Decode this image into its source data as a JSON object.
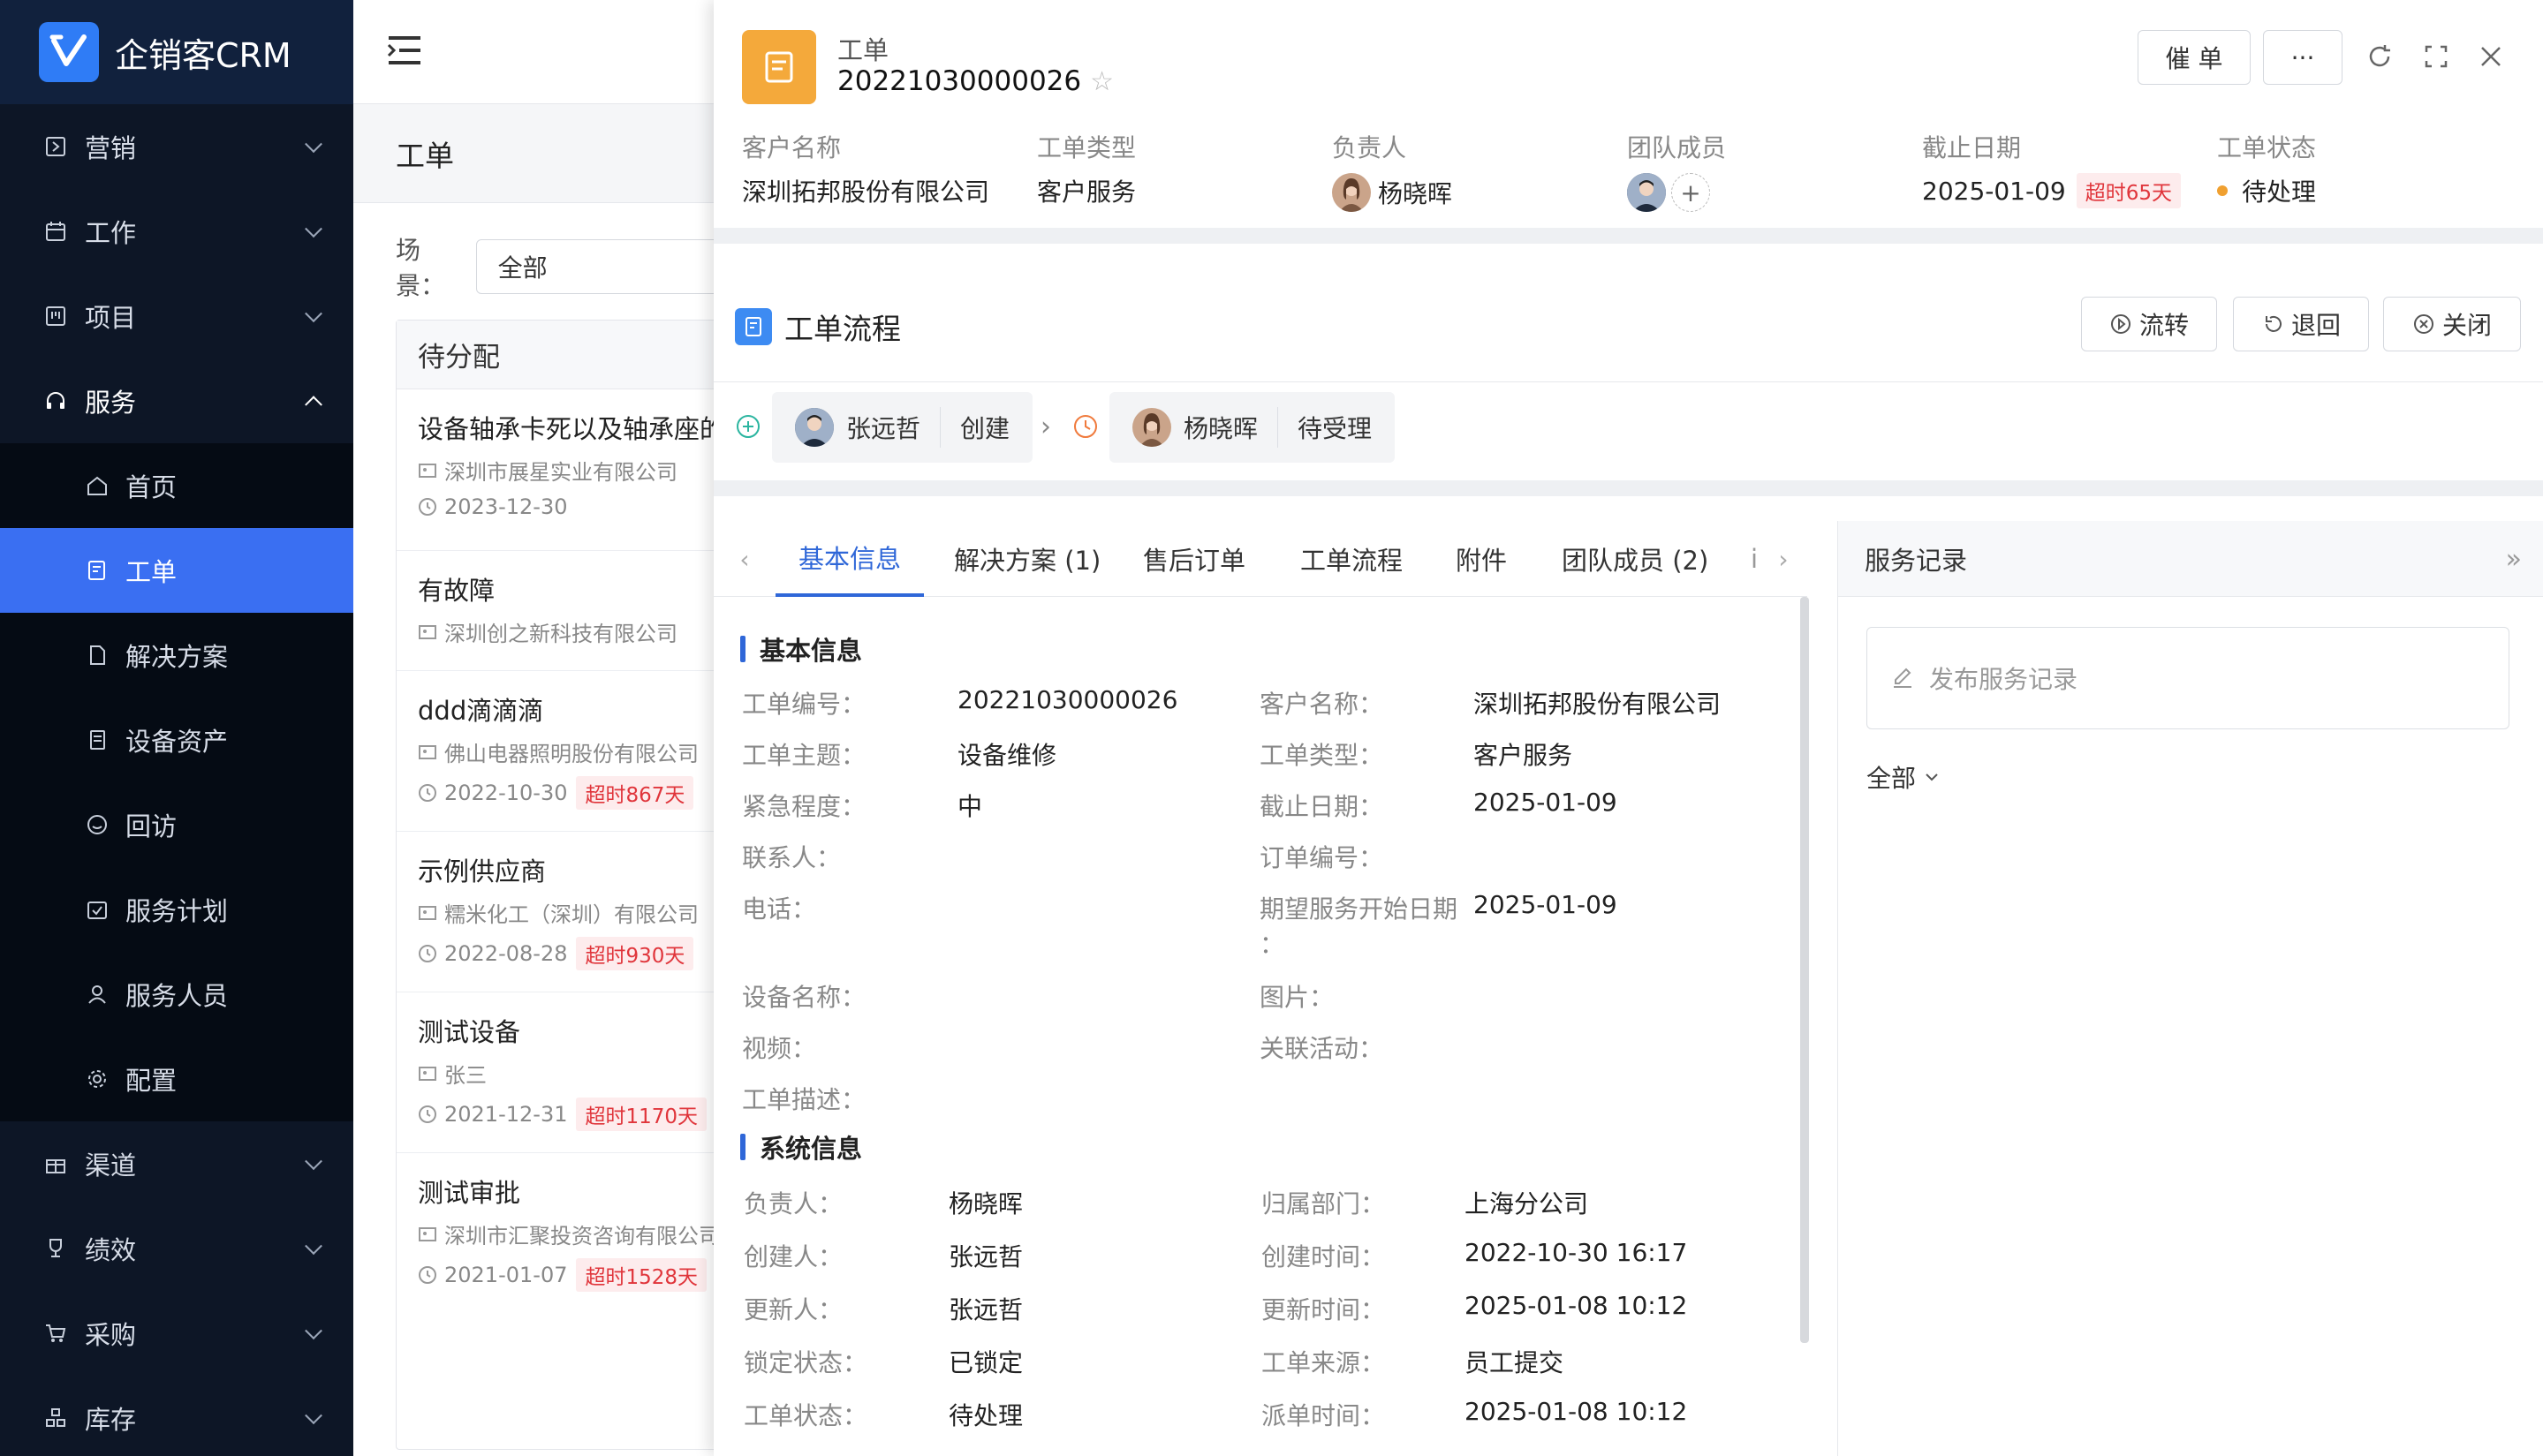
{
  "app": {
    "name": "企销客CRM"
  },
  "sidebar": {
    "top_items": [
      {
        "label": "营销",
        "icon": "marketing-icon"
      },
      {
        "label": "工作",
        "icon": "calendar-icon"
      },
      {
        "label": "项目",
        "icon": "project-icon"
      },
      {
        "label": "服务",
        "icon": "headset-icon"
      }
    ],
    "service_sub": [
      {
        "label": "首页",
        "icon": "home-icon"
      },
      {
        "label": "工单",
        "icon": "ticket-icon"
      },
      {
        "label": "解决方案",
        "icon": "document-icon"
      },
      {
        "label": "设备资产",
        "icon": "asset-icon"
      },
      {
        "label": "回访",
        "icon": "smile-icon"
      },
      {
        "label": "服务计划",
        "icon": "plan-icon"
      },
      {
        "label": "服务人员",
        "icon": "person-icon"
      },
      {
        "label": "配置",
        "icon": "gear-icon"
      }
    ],
    "bottom_items": [
      {
        "label": "渠道",
        "icon": "gift-icon"
      },
      {
        "label": "绩效",
        "icon": "trophy-icon"
      },
      {
        "label": "采购",
        "icon": "cart-icon"
      },
      {
        "label": "库存",
        "icon": "stock-icon"
      }
    ]
  },
  "list": {
    "page_title": "工单",
    "scene_label": "场景：",
    "scene_value": "全部",
    "column_title": "待分配",
    "cards": [
      {
        "title": "设备轴承卡死以及轴承座的",
        "company": "深圳市展星实业有限公司",
        "date": "2023-12-30",
        "overdue": ""
      },
      {
        "title": "有故障",
        "company": "深圳创之新科技有限公司",
        "date": "",
        "overdue": ""
      },
      {
        "title": "ddd滴滴滴",
        "company": "佛山电器照明股份有限公司",
        "date": "2022-10-30",
        "overdue": "超时867天"
      },
      {
        "title": "示例供应商",
        "company": "糯米化工（深圳）有限公司",
        "date": "2022-08-28",
        "overdue": "超时930天"
      },
      {
        "title": "测试设备",
        "company": "张三",
        "date": "2021-12-31",
        "overdue": "超时1170天"
      },
      {
        "title": "测试审批",
        "company": "深圳市汇聚投资咨询有限公司",
        "date": "2021-01-07",
        "overdue": "超时1528天"
      }
    ]
  },
  "drawer": {
    "kind": "工单",
    "number": "20221030000026",
    "buttons": {
      "urge": "催 单",
      "more": "···"
    },
    "meta": {
      "customer_label": "客户名称",
      "customer": "深圳拓邦股份有限公司",
      "type_label": "工单类型",
      "type": "客户服务",
      "owner_label": "负责人",
      "owner": "杨晓晖",
      "team_label": "团队成员",
      "due_label": "截止日期",
      "due": "2025-01-09",
      "due_overdue": "超时65天",
      "status_label": "工单状态",
      "status": "待处理"
    },
    "flow": {
      "title": "工单流程",
      "actions": {
        "transfer": "流转",
        "return": "退回",
        "close": "关闭"
      },
      "steps": [
        {
          "person": "张远哲",
          "action": "创建"
        },
        {
          "person": "杨晓晖",
          "action": "待受理"
        }
      ]
    },
    "tabs": [
      "基本信息",
      "解决方案 (1)",
      "售后订单",
      "工单流程",
      "附件",
      "团队成员 (2)",
      "i"
    ],
    "basic": {
      "section1": "基本信息",
      "fields_left": [
        {
          "k": "工单编号：",
          "v": "20221030000026"
        },
        {
          "k": "工单主题：",
          "v": "设备维修"
        },
        {
          "k": "紧急程度：",
          "v": "中"
        },
        {
          "k": "联系人：",
          "v": ""
        },
        {
          "k": "电话：",
          "v": ""
        },
        {
          "k": "设备名称：",
          "v": ""
        },
        {
          "k": "视频：",
          "v": ""
        },
        {
          "k": "工单描述：",
          "v": ""
        }
      ],
      "fields_right": [
        {
          "k": "客户名称：",
          "v": "深圳拓邦股份有限公司"
        },
        {
          "k": "工单类型：",
          "v": "客户服务"
        },
        {
          "k": "截止日期：",
          "v": "2025-01-09"
        },
        {
          "k": "订单编号：",
          "v": ""
        },
        {
          "k": "期望服务开始日期",
          "k2": "：",
          "v": "2025-01-09"
        },
        {
          "k": "图片：",
          "v": ""
        },
        {
          "k": "关联活动：",
          "v": ""
        }
      ],
      "section2": "系统信息",
      "sys_left": [
        {
          "k": "负责人：",
          "v": "杨晓晖"
        },
        {
          "k": "创建人：",
          "v": "张远哲"
        },
        {
          "k": "更新人：",
          "v": "张远哲"
        },
        {
          "k": "锁定状态：",
          "v": "已锁定"
        },
        {
          "k": "工单状态：",
          "v": "待处理"
        }
      ],
      "sys_right": [
        {
          "k": "归属部门：",
          "v": "上海分公司"
        },
        {
          "k": "创建时间：",
          "v": "2022-10-30 16:17"
        },
        {
          "k": "更新时间：",
          "v": "2025-01-08 10:12"
        },
        {
          "k": "工单来源：",
          "v": "员工提交"
        },
        {
          "k": "派单时间：",
          "v": "2025-01-08 10:12"
        }
      ]
    },
    "service_record": {
      "title": "服务记录",
      "post_placeholder": "发布服务记录",
      "filter": "全部"
    }
  }
}
